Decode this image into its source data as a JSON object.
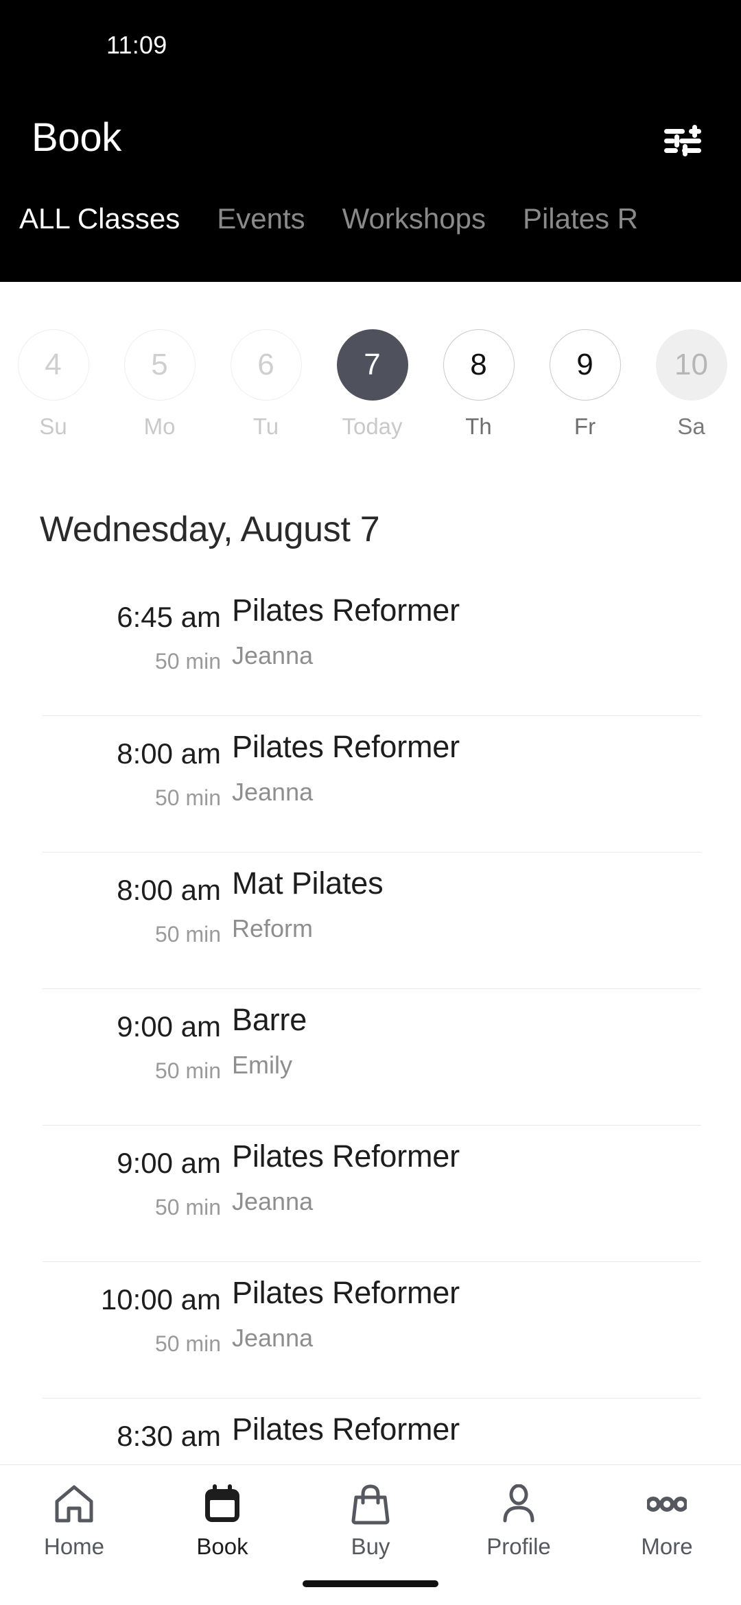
{
  "status_bar": {
    "time": "11:09"
  },
  "app_bar": {
    "title": "Book",
    "filter_icon": "tune-filter-icon"
  },
  "tabs": {
    "items": [
      {
        "label": "ALL Classes",
        "active": true
      },
      {
        "label": "Events",
        "active": false
      },
      {
        "label": "Workshops",
        "active": false
      },
      {
        "label": "Pilates R",
        "active": false
      }
    ]
  },
  "date_strip": {
    "days": [
      {
        "number": "4",
        "label": "Su",
        "state": "disabled"
      },
      {
        "number": "5",
        "label": "Mo",
        "state": "disabled"
      },
      {
        "number": "6",
        "label": "Tu",
        "state": "disabled"
      },
      {
        "number": "7",
        "label": "Today",
        "state": "today"
      },
      {
        "number": "8",
        "label": "Th",
        "state": "enabled"
      },
      {
        "number": "9",
        "label": "Fr",
        "state": "enabled"
      },
      {
        "number": "10",
        "label": "Sa",
        "state": "shaded"
      }
    ]
  },
  "schedule": {
    "heading": "Wednesday, August 7",
    "classes": [
      {
        "time": "6:45 am",
        "duration": "50 min",
        "name": "Pilates Reformer",
        "instructor": "Jeanna"
      },
      {
        "time": "8:00 am",
        "duration": "50 min",
        "name": "Pilates Reformer",
        "instructor": "Jeanna"
      },
      {
        "time": "8:00 am",
        "duration": "50 min",
        "name": "Mat Pilates",
        "instructor": "Reform"
      },
      {
        "time": "9:00 am",
        "duration": "50 min",
        "name": "Barre",
        "instructor": "Emily"
      },
      {
        "time": "9:00 am",
        "duration": "50 min",
        "name": "Pilates Reformer",
        "instructor": "Jeanna"
      },
      {
        "time": "10:00 am",
        "duration": "50 min",
        "name": "Pilates Reformer",
        "instructor": "Jeanna"
      },
      {
        "time": "8:30 am",
        "duration": "",
        "name": "Pilates Reformer",
        "instructor": ""
      }
    ]
  },
  "bottom_nav": {
    "items": [
      {
        "label": "Home",
        "icon": "home-icon",
        "active": false
      },
      {
        "label": "Book",
        "icon": "calendar-icon",
        "active": true
      },
      {
        "label": "Buy",
        "icon": "bag-icon",
        "active": false
      },
      {
        "label": "Profile",
        "icon": "person-icon",
        "active": false
      },
      {
        "label": "More",
        "icon": "ellipsis-icon",
        "active": false
      }
    ]
  },
  "colors": {
    "header_background": "#000000",
    "today_circle": "#4f525c",
    "shaded_circle": "#efefef",
    "divider": "#e9e9e9",
    "muted_text": "#8e8e8e",
    "nav_icon": "#55585e"
  }
}
